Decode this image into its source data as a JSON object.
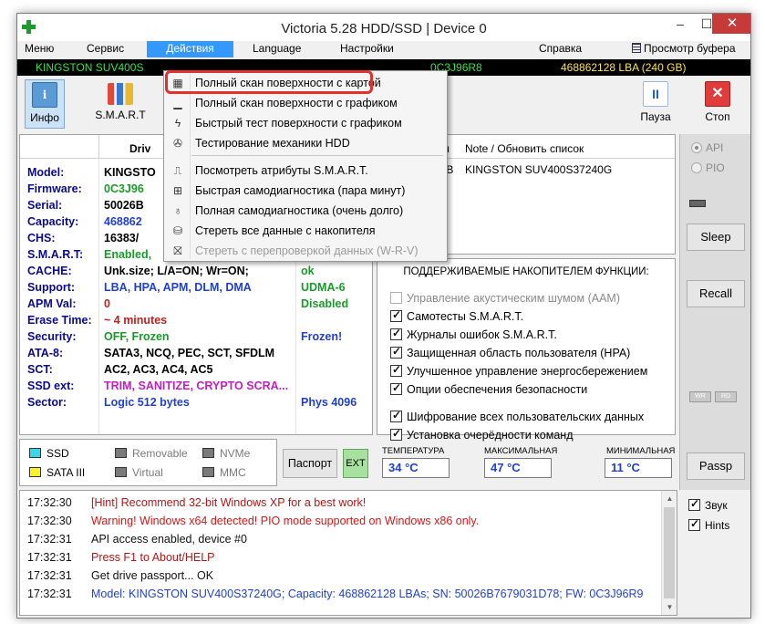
{
  "window": {
    "title": "Victoria 5.28 HDD/SSD | Device 0",
    "minimize": "–",
    "maximize": "☐",
    "close": "✕"
  },
  "menu": {
    "items": [
      {
        "label": "Меню"
      },
      {
        "label": "Сервис"
      },
      {
        "label": "Действия"
      },
      {
        "label": "Language"
      },
      {
        "label": "Настройки"
      },
      {
        "label": "Справка"
      }
    ],
    "buffer_label": "Просмотр буфера"
  },
  "drivebar": {
    "model": "KINGSTON SUV400S",
    "firmware": "0C3J96R8",
    "lba": "468862128 LBA (240 GB)"
  },
  "toolbar": {
    "info_label": "Инфо",
    "info_icon": "i",
    "smart_label": "S.M.A.R.T",
    "pause_label": "Пауза",
    "pause_icon": "II",
    "stop_label": "Стоп",
    "stop_icon": "✕"
  },
  "info": {
    "header": "Driv",
    "rows": [
      {
        "key": "Model:",
        "value": "KINGSTO",
        "extra": "",
        "vcolor": "#000000",
        "ecolor": "#000000"
      },
      {
        "key": "Firmware:",
        "value": "0C3J96",
        "extra": "",
        "vcolor": "#1a9a2a",
        "ecolor": "#000000"
      },
      {
        "key": "Serial:",
        "value": "50026B",
        "extra": "",
        "vcolor": "#000000",
        "ecolor": "#000000"
      },
      {
        "key": "Capacity:",
        "value": "468862",
        "extra": "",
        "vcolor": "#1f3fd0",
        "ecolor": "#000000"
      },
      {
        "key": "CHS:",
        "value": "16383/",
        "extra": "",
        "vcolor": "#000000",
        "ecolor": "#000000"
      },
      {
        "key": "S.M.A.R.T:",
        "value": "Enabled, ",
        "extra": "",
        "vcolor": "#1a9a2a",
        "ecolor": "#000000"
      },
      {
        "key": "CACHE:",
        "value": "Unk.size; L/A=ON; Wr=ON;",
        "extra": "ok",
        "vcolor": "#000000",
        "ecolor": "#1a9a2a"
      },
      {
        "key": "Support:",
        "value": "LBA, HPA, APM, DLM, DMA",
        "extra": "UDMA-6",
        "vcolor": "#1f3fd0",
        "ecolor": "#1a9a2a"
      },
      {
        "key": "APM Val:",
        "value": "0",
        "extra": "Disabled",
        "vcolor": "#c02020",
        "ecolor": "#1a9a2a"
      },
      {
        "key": "Erase Time:",
        "value": "~ 4 minutes",
        "extra": "",
        "vcolor": "#c02020",
        "ecolor": "#000000"
      },
      {
        "key": "Security:",
        "value": "OFF, Frozen",
        "extra": "Frozen!",
        "vcolor": "#1a9a2a",
        "ecolor": "#1f3fd0"
      },
      {
        "key": "ATA-8:",
        "value": "SATA3, NCQ, PEC, SCT, SFDLM",
        "extra": "",
        "vcolor": "#000000",
        "ecolor": "#000000"
      },
      {
        "key": "SCT:",
        "value": "AC2, AC3, AC4, AC5",
        "extra": "",
        "vcolor": "#000000",
        "ecolor": "#000000"
      },
      {
        "key": "SSD ext:",
        "value": "TRIM, SANITIZE, CRYPTO SCRA...",
        "extra": "",
        "vcolor": "#c020c0",
        "ecolor": "#000000"
      },
      {
        "key": "Sector:",
        "value": "Logic 512 bytes",
        "extra": "Phys 4096",
        "vcolor": "#1f3fd0",
        "ecolor": "#1f3fd0"
      }
    ]
  },
  "devices": {
    "col1": "ём",
    "col2": "Note / Обновить список",
    "row_size": "GB",
    "row_name": "KINGSTON SUV400S37240G"
  },
  "features": {
    "title": "ПОДДЕРЖИВАЕМЫЕ НАКОПИТЕЛЕМ ФУНКЦИИ:",
    "items": [
      {
        "label": "Управление акустическим шумом (AAM)",
        "checked": false,
        "disabled": true
      },
      {
        "label": "Самотесты S.M.A.R.T.",
        "checked": true,
        "disabled": false
      },
      {
        "label": "Журналы ошибок S.M.A.R.T.",
        "checked": true,
        "disabled": false
      },
      {
        "label": "Защищенная область пользователя (HPA)",
        "checked": true,
        "disabled": false
      },
      {
        "label": "Улучшенное управление энергосбережением",
        "checked": true,
        "disabled": false
      },
      {
        "label": "Опции обеспечения безопасности",
        "checked": true,
        "disabled": false
      },
      {
        "label": "Шифрование всех пользовательских данных",
        "checked": true,
        "disabled": false
      },
      {
        "label": "Установка очерёдности команд",
        "checked": true,
        "disabled": false
      }
    ]
  },
  "right": {
    "api_label": "API",
    "pio_label": "PIO",
    "sleep": "Sleep",
    "recall": "Recall",
    "passp": "Passp",
    "mini_wr": "WR",
    "mini_rd": "RD"
  },
  "types": {
    "ssd": "SSD",
    "sata": "SATA III",
    "removable": "Removable",
    "virtual": "Virtual",
    "nvme": "NVMe",
    "mmc": "MMC",
    "ssd_color": "#37d6e8",
    "sata_color": "#f6f22c"
  },
  "passport_label": "Паспорт",
  "ext_label": "EXT",
  "temps": {
    "current_label": "ТЕМПЕРАТУРА",
    "current": "34 °C",
    "max_label": "МАКСИМАЛЬНАЯ",
    "max": "47 °C",
    "min_label": "МИНИМАЛЬНАЯ",
    "min": "11 °C"
  },
  "log": [
    {
      "time": "17:32:30",
      "msg": "[Hint] Recommend 32-bit Windows XP for a best work!",
      "color": "#b01818"
    },
    {
      "time": "17:32:30",
      "msg": "Warning! Windows x64 detected! PIO mode supported on Windows x86 only.",
      "color": "#d01818"
    },
    {
      "time": "17:32:31",
      "msg": "API access enabled, device #0",
      "color": "#111111"
    },
    {
      "time": "17:32:31",
      "msg": "Press F1 to About/HELP",
      "color": "#b01818"
    },
    {
      "time": "17:32:31",
      "msg": "Get drive passport... OK",
      "color": "#111111"
    },
    {
      "time": "17:32:31",
      "msg": "Model: KINGSTON SUV400S37240G; Capacity: 468862128 LBAs; SN: 50026B7679031D78; FW: 0C3J96R9",
      "color": "#1f3fd0"
    }
  ],
  "log_opts": {
    "sound": "Звук",
    "hints": "Hints"
  },
  "dropdown": {
    "items": [
      {
        "label": "Полный скан поверхности с картой",
        "icon": "▦",
        "disabled": false
      },
      {
        "label": "Полный скан поверхности с графиком",
        "icon": "▁",
        "disabled": false
      },
      {
        "label": "Быстрый тест поверхности с графиком",
        "icon": "ϟ",
        "disabled": false
      },
      {
        "label": "Тестирование механики HDD",
        "icon": "✇",
        "disabled": false
      },
      {
        "label": "Посмотреть атрибуты S.M.A.R.T.",
        "icon": "⎍",
        "disabled": false
      },
      {
        "label": "Быстрая самодиагностика (пара минут)",
        "icon": "⊞",
        "disabled": false
      },
      {
        "label": "Полная самодиагностика (очень долго)",
        "icon": "♁",
        "disabled": false
      },
      {
        "label": "Стереть все данные с накопителя",
        "icon": "⛁",
        "disabled": false
      },
      {
        "label": "Стереть с перепроверкой данных (W-R-V)",
        "icon": "⛝",
        "disabled": true
      }
    ]
  }
}
